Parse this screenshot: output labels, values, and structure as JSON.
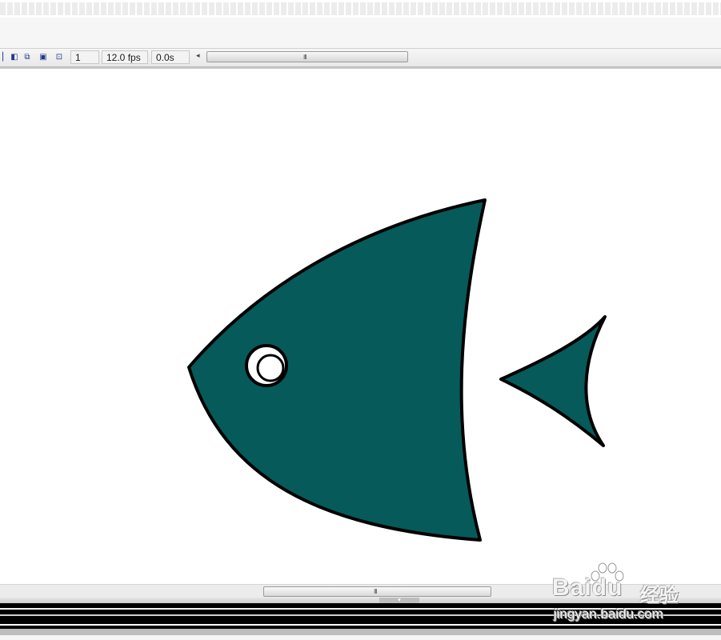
{
  "timeline": {
    "frame_number": "1",
    "frame_rate": "12.0 fps",
    "elapsed_time": "0.0s",
    "buttons": [
      {
        "name": "center-frame-icon",
        "glyph": "◧"
      },
      {
        "name": "onion-skin-icon",
        "glyph": "⧉"
      },
      {
        "name": "onion-skin-outlines-icon",
        "glyph": "▣"
      },
      {
        "name": "edit-multiple-frames-icon",
        "glyph": "⊡"
      }
    ],
    "scroll_left_glyph": "◂",
    "scroll_grip": "III"
  },
  "stage": {
    "fish": {
      "body_color": "#065a5a",
      "outline_color": "#000000",
      "eye_color": "#ffffff"
    }
  },
  "bottom_scroll": {
    "grip": "III",
    "collapse_glyph": "▾"
  },
  "watermark": {
    "brand": "Baidu",
    "brand_cn": "经验",
    "url": "jingyan.baidu.com"
  }
}
